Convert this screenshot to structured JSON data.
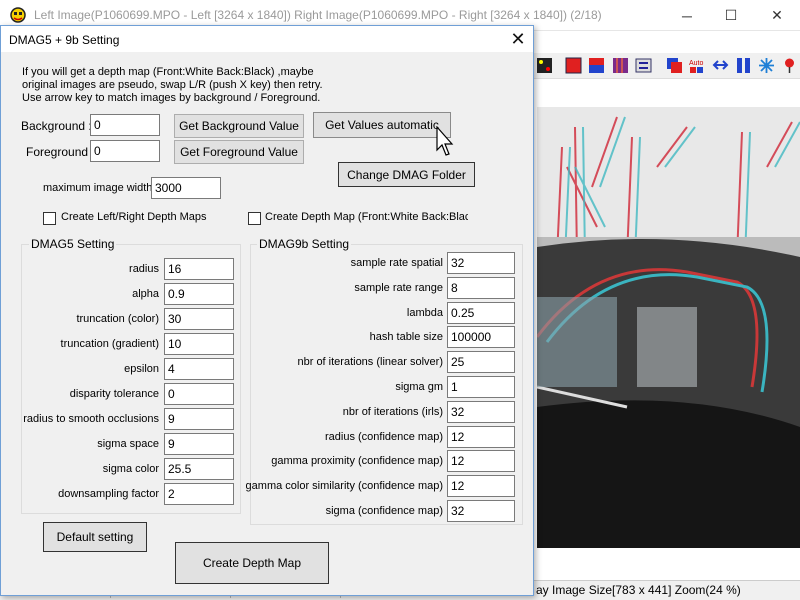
{
  "main_window": {
    "title": "Left Image(P1060699.MPO - Left [3264 x 1840])  Right Image(P1060699.MPO - Right [3264 x 1840])  (2/18)",
    "minimize_glyph": "─",
    "maximize_glyph": "☐",
    "close_glyph": "✕",
    "status": "ay Image Size[783 x 441]  Zoom(24 %)"
  },
  "dialog": {
    "title": "DMAG5 + 9b Setting",
    "close_glyph": "✕",
    "instructions": [
      "If you will get a depth map (Front:White Back:Black) ,maybe",
      "original images are pseudo, swap L/R (push X key) then retry.",
      "Use arrow key to match images by background / Foreground."
    ],
    "background_label": "Background :",
    "background_value": "0",
    "foreground_label": "Foreground :",
    "foreground_value": "0",
    "get_background_button": "Get Background Value",
    "get_foreground_button": "Get Foreground Value",
    "get_values_auto_button": "Get Values automatic",
    "change_folder_button": "Change DMAG Folder",
    "max_width_label": "maximum image width",
    "max_width_value": "3000",
    "create_lr_maps_label": "Create Left/Right Depth Maps",
    "create_depth_front_label": "Create Depth Map (Front:White Back:Black",
    "dmag5": {
      "title": "DMAG5 Setting",
      "fields": [
        {
          "label": "radius",
          "value": "16"
        },
        {
          "label": "alpha",
          "value": "0.9"
        },
        {
          "label": "truncation (color)",
          "value": "30"
        },
        {
          "label": "truncation (gradient)",
          "value": "10"
        },
        {
          "label": "epsilon",
          "value": "4"
        },
        {
          "label": "disparity tolerance",
          "value": "0"
        },
        {
          "label": "radius to smooth occlusions",
          "value": "9"
        },
        {
          "label": "sigma space",
          "value": "9"
        },
        {
          "label": "sigma color",
          "value": "25.5"
        },
        {
          "label": "downsampling factor",
          "value": "2"
        }
      ]
    },
    "dmag9b": {
      "title": "DMAG9b Setting",
      "fields": [
        {
          "label": "sample rate spatial",
          "value": "32"
        },
        {
          "label": "sample rate range",
          "value": "8"
        },
        {
          "label": "lambda",
          "value": "0.25"
        },
        {
          "label": "hash table size",
          "value": "100000"
        },
        {
          "label": "nbr of iterations (linear solver)",
          "value": "25"
        },
        {
          "label": "sigma gm",
          "value": "1"
        },
        {
          "label": "nbr of iterations (irls)",
          "value": "32"
        },
        {
          "label": "radius (confidence map)",
          "value": "12"
        },
        {
          "label": "gamma proximity (confidence map)",
          "value": "12"
        },
        {
          "label": "gamma color similarity (confidence map)",
          "value": "12"
        },
        {
          "label": "sigma (confidence map)",
          "value": "32"
        }
      ]
    },
    "default_button": "Default setting",
    "create_depth_button": "Create Depth Map"
  },
  "toolbar_icons": [
    "grid-icon",
    "red-square-icon",
    "red-blue-icon",
    "stripes-icon",
    "convert-icon",
    "red-square-2-icon",
    "auto-icon",
    "arrows-icon",
    "columns-icon",
    "snowflake-icon",
    "pin-icon"
  ],
  "colors": {
    "accent_border": "#6f9fd6",
    "dialog_bg": "#f0f0f0"
  }
}
